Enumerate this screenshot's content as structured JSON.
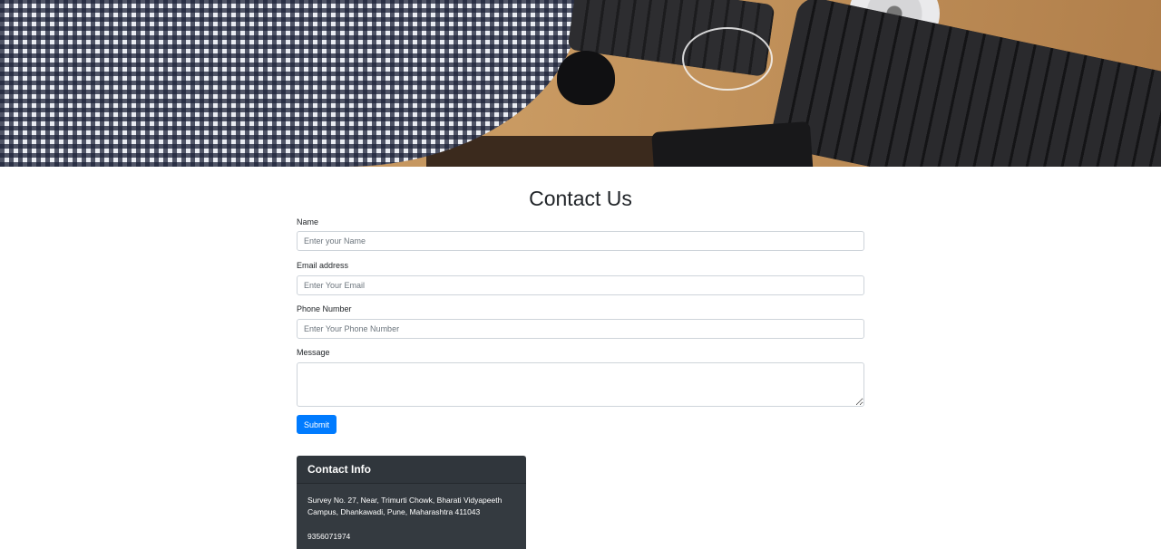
{
  "page": {
    "title": "Contact Us"
  },
  "form": {
    "name": {
      "label": "Name",
      "placeholder": "Enter your Name"
    },
    "email": {
      "label": "Email address",
      "placeholder": "Enter Your Email"
    },
    "phone": {
      "label": "Phone Number",
      "placeholder": "Enter Your Phone Number"
    },
    "message": {
      "label": "Message"
    },
    "submit_label": "Submit"
  },
  "contact_info": {
    "heading": "Contact Info",
    "address": "Survey No. 27, Near, Trimurti Chowk, Bharati Vidyapeeth Campus, Dhankawadi, Pune, Maharashtra 411043",
    "phone": "9356071974"
  },
  "colors": {
    "primary": "#007bff",
    "card_bg": "#343a40"
  }
}
